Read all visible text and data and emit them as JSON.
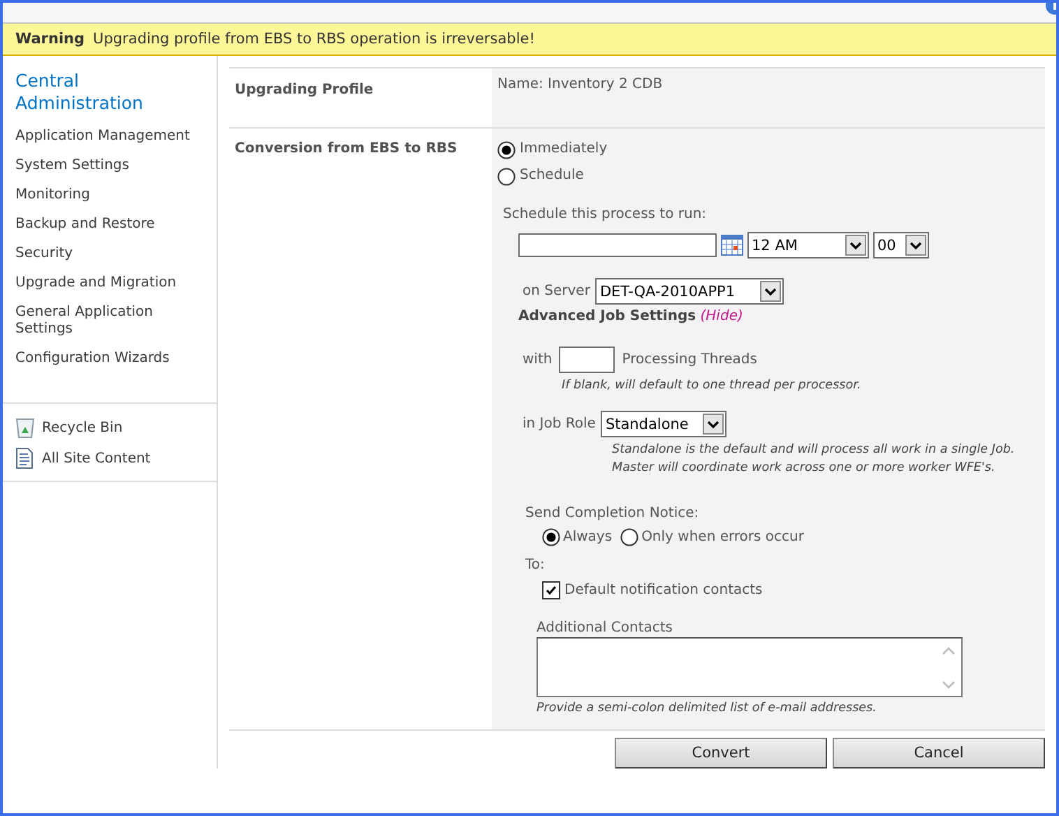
{
  "warning": {
    "label": "Warning",
    "message": "Upgrading profile from EBS to RBS operation is irreversable!"
  },
  "sidebar": {
    "title": "Central Administration",
    "items": [
      "Application Management",
      "System Settings",
      "Monitoring",
      "Backup and Restore",
      "Security",
      "Upgrade and Migration",
      "General Application Settings",
      "Configuration Wizards"
    ],
    "links": [
      {
        "label": "Recycle Bin",
        "kind": "recycle"
      },
      {
        "label": "All Site Content",
        "kind": "content"
      }
    ]
  },
  "profile": {
    "label": "Upgrading Profile",
    "value": "Name: Inventory 2 CDB"
  },
  "conversion": {
    "label": "Conversion from EBS to RBS",
    "options": [
      {
        "label": "Immediately",
        "selected": true
      },
      {
        "label": "Schedule",
        "selected": false
      }
    ],
    "schedule_label": "Schedule this process to run:",
    "hour": "12 AM",
    "minute": "00",
    "server_label": "on Server",
    "server": "DET-QA-2010APP1",
    "advanced_title": "Advanced Job Settings",
    "hide_link": "(Hide)",
    "threads_prefix": "with",
    "threads_suffix": "Processing Threads",
    "threads_hint": "If blank, will default to one thread per processor.",
    "role_label": "in Job Role",
    "role": "Standalone",
    "role_hint": [
      "Standalone is the default and will process all work in a single Job.",
      "Master will coordinate work across one or more worker WFE's."
    ],
    "notice_label": "Send Completion Notice:",
    "notice_options": [
      {
        "label": "Always",
        "selected": true
      },
      {
        "label": "Only when errors occur",
        "selected": false
      }
    ],
    "to_label": "To:",
    "default_contacts": {
      "label": "Default notification contacts",
      "checked": true
    },
    "additional_label": "Additional Contacts",
    "additional_hint": "Provide a semi-colon delimited list of e-mail addresses."
  },
  "buttons": [
    "Convert",
    "Cancel"
  ]
}
